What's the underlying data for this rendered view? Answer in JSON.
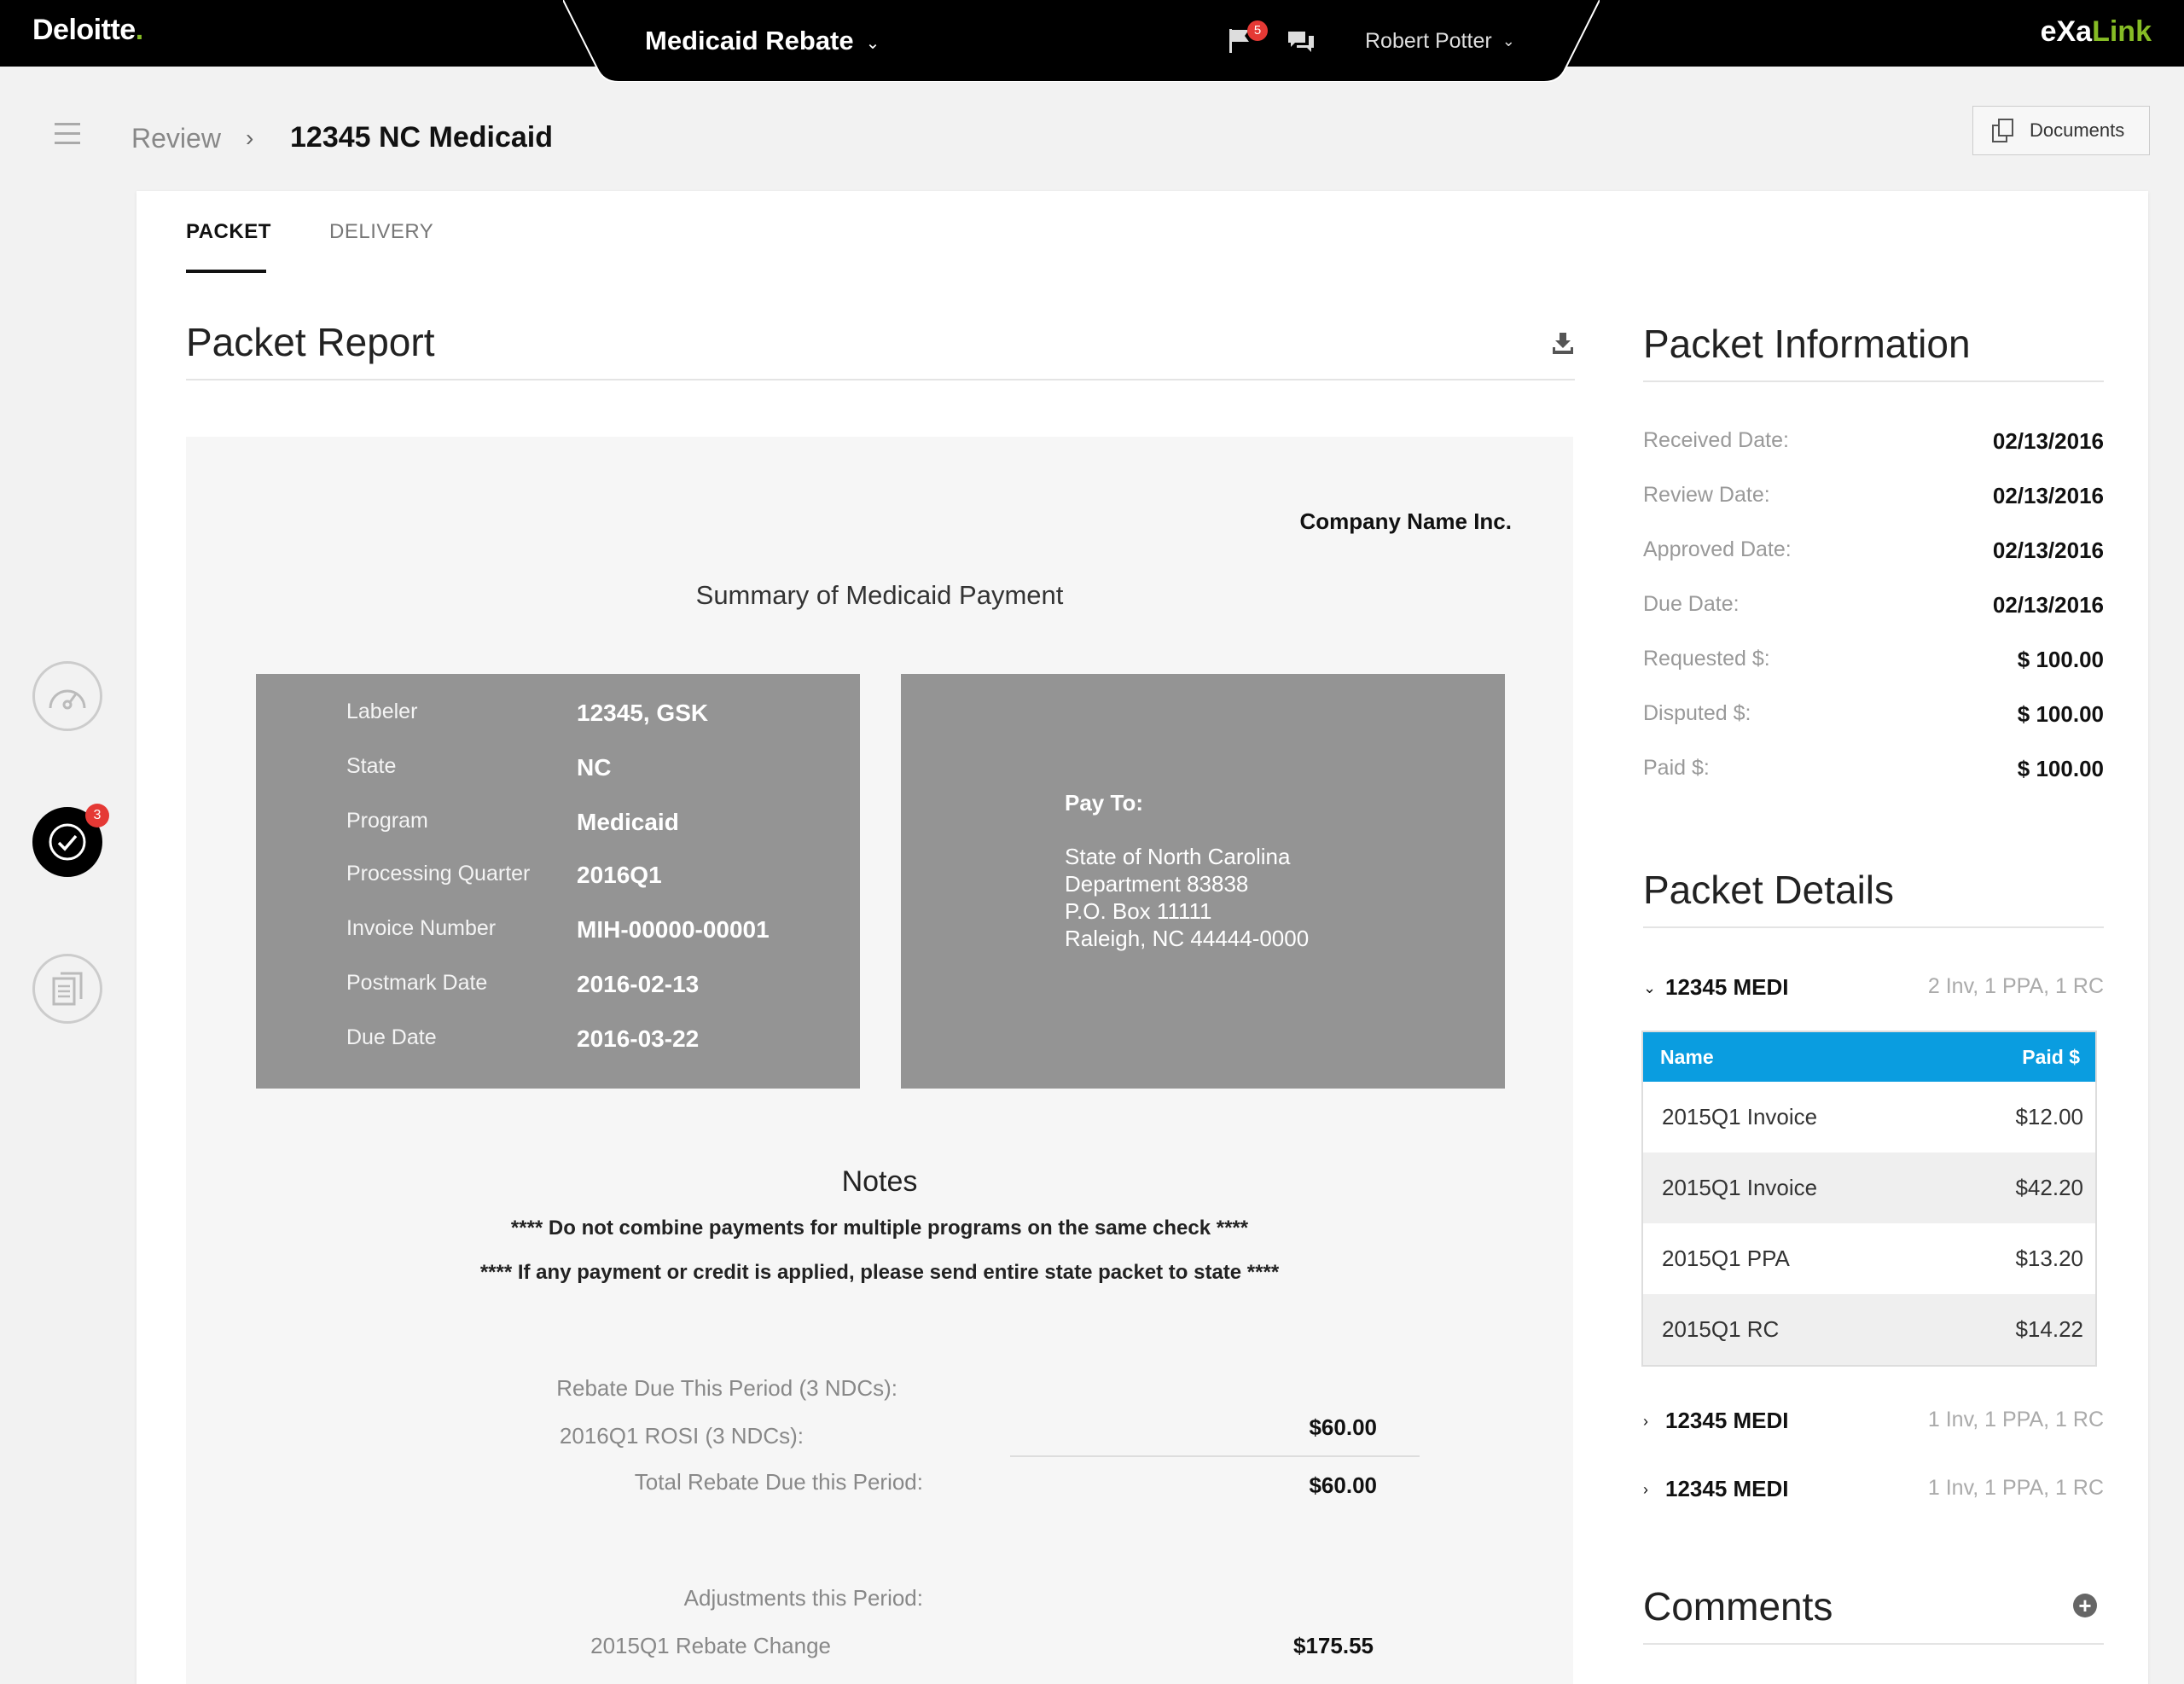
{
  "topbar": {
    "logo": "Deloitte",
    "logo_dot": ".",
    "app_name": "Medicaid Rebate",
    "flag_count": "5",
    "user_name": "Robert Potter",
    "brand_prefix": "eXa",
    "brand_suffix": "Link"
  },
  "header": {
    "breadcrumb_parent": "Review",
    "breadcrumb_current": "12345 NC Medicaid",
    "documents_label": "Documents"
  },
  "rail": {
    "badge_count": "3"
  },
  "tabs": [
    {
      "label": "PACKET"
    },
    {
      "label": "DELIVERY"
    }
  ],
  "report": {
    "title": "Packet Report",
    "company": "Company Name Inc.",
    "summary_title": "Summary of Medicaid Payment",
    "fields": [
      {
        "label": "Labeler",
        "value": "12345, GSK"
      },
      {
        "label": "State",
        "value": "NC"
      },
      {
        "label": "Program",
        "value": "Medicaid"
      },
      {
        "label": "Processing Quarter",
        "value": "2016Q1"
      },
      {
        "label": "Invoice Number",
        "value": "MIH-00000-00001"
      },
      {
        "label": "Postmark Date",
        "value": "2016-02-13"
      },
      {
        "label": "Due Date",
        "value": "2016-03-22"
      }
    ],
    "pay_to_label": "Pay To:",
    "pay_to_lines": [
      "State of North Carolina",
      "Department 83838",
      "P.O. Box 11111",
      "Raleigh, NC 44444-0000"
    ],
    "notes_title": "Notes",
    "notes": [
      "**** Do not combine payments for multiple programs on the same check ****",
      "**** If any payment or credit is applied, please send entire state packet to state ****"
    ],
    "calc": {
      "rebate_due_label": "Rebate Due This Period (3 NDCs):",
      "rosi_label": "2016Q1 ROSI (3 NDCs):",
      "rosi_value": "$60.00",
      "total_label": "Total Rebate Due this Period:",
      "total_value": "$60.00",
      "adjustments_label": "Adjustments this Period:",
      "rebate_change_label": "2015Q1 Rebate Change",
      "rebate_change_value": "$175.55"
    }
  },
  "packet_info": {
    "title": "Packet Information",
    "rows": [
      {
        "label": "Received Date:",
        "value": "02/13/2016"
      },
      {
        "label": "Review Date:",
        "value": "02/13/2016"
      },
      {
        "label": "Approved Date:",
        "value": "02/13/2016"
      },
      {
        "label": "Due Date:",
        "value": "02/13/2016"
      },
      {
        "label": "Requested $:",
        "value": "$ 100.00"
      },
      {
        "label": "Disputed $:",
        "value": "$ 100.00"
      },
      {
        "label": "Paid $:",
        "value": "$ 100.00"
      }
    ]
  },
  "packet_details": {
    "title": "Packet Details",
    "groups": [
      {
        "name": "12345 MEDI",
        "meta": "2 Inv, 1 PPA, 1 RC",
        "expanded": true
      },
      {
        "name": "12345 MEDI",
        "meta": "1 Inv, 1 PPA, 1 RC",
        "expanded": false
      },
      {
        "name": "12345 MEDI",
        "meta": "1 Inv, 1 PPA, 1 RC",
        "expanded": false
      }
    ],
    "table": {
      "headers": [
        "Name",
        "Paid $"
      ],
      "rows": [
        {
          "name": "2015Q1 Invoice",
          "paid": "$12.00"
        },
        {
          "name": "2015Q1 Invoice",
          "paid": "$42.20"
        },
        {
          "name": "2015Q1 PPA",
          "paid": "$13.20"
        },
        {
          "name": "2015Q1 RC",
          "paid": "$14.22"
        }
      ]
    }
  },
  "comments": {
    "title": "Comments"
  },
  "colors": {
    "accent": "#0a9de0",
    "brand_green": "#86bc25",
    "badge_red": "#e53935",
    "report_box_gray": "#949494"
  }
}
